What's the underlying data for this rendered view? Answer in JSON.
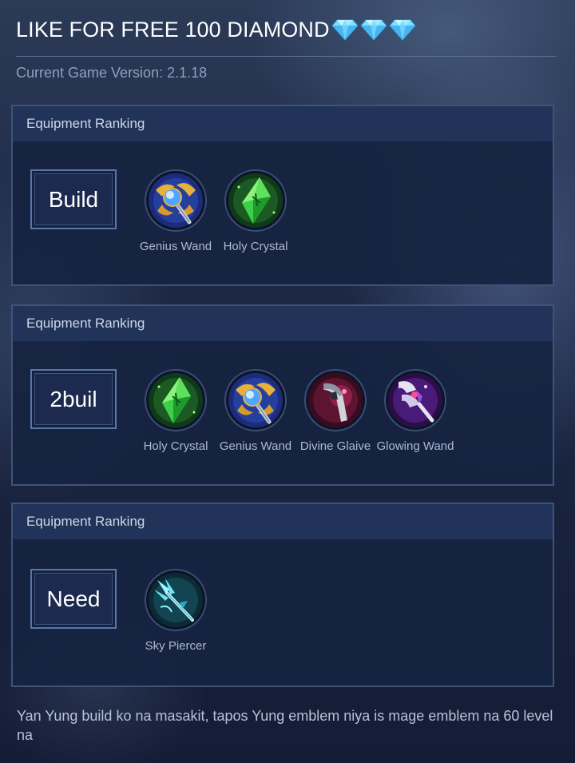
{
  "header": {
    "title": "LIKE FOR FREE 100 DIAMOND",
    "title_gem_icons": [
      "gem-icon",
      "gem-icon",
      "gem-icon"
    ],
    "version": "Current Game Version: 2.1.18"
  },
  "colors": {
    "background": "#141d35",
    "panel_bg": "#162342",
    "panel_header_bg": "#223359",
    "panel_border": "#3e5378",
    "label_border": "#5877a8",
    "item_text": "#aebad0",
    "gem": "#5fd4ff"
  },
  "panels": [
    {
      "header": "Equipment Ranking",
      "label": "Build",
      "items": [
        {
          "name": "Genius Wand",
          "icon": "genius-wand-icon"
        },
        {
          "name": "Holy Crystal",
          "icon": "holy-crystal-icon"
        }
      ]
    },
    {
      "header": "Equipment Ranking",
      "label": "2buil",
      "items": [
        {
          "name": "Holy Crystal",
          "icon": "holy-crystal-icon"
        },
        {
          "name": "Genius Wand",
          "icon": "genius-wand-icon"
        },
        {
          "name": "Divine Glaive",
          "icon": "divine-glaive-icon"
        },
        {
          "name": "Glowing Wand",
          "icon": "glowing-wand-icon"
        }
      ]
    },
    {
      "header": "Equipment Ranking",
      "label": "Need",
      "items": [
        {
          "name": "Sky Piercer",
          "icon": "sky-piercer-icon"
        }
      ]
    }
  ],
  "comment": "Yan Yung build ko na masakit, tapos Yung emblem niya is mage emblem na 60 level na"
}
